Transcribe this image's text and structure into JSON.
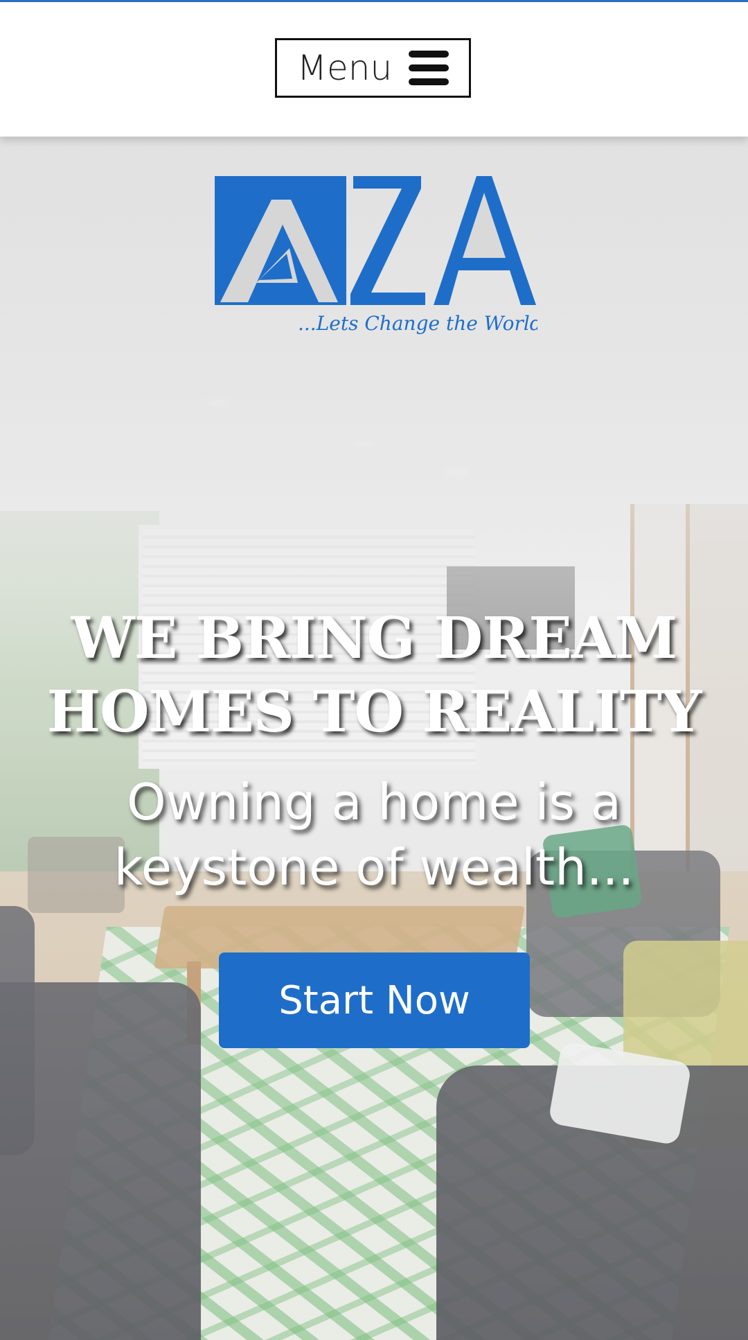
{
  "header": {
    "menu_label": "Menu"
  },
  "logo": {
    "letters": "ZA",
    "tagline": "...Lets Change the World",
    "brand_color": "#1e6ec9"
  },
  "hero": {
    "headline_line1": "WE BRING DREAM",
    "headline_line2": "HOMES TO REALITY",
    "sub_line1": "Owning a home is a",
    "sub_line2": "keystone of wealth...",
    "cta_label": "Start Now",
    "cta_color": "#1e6ec9"
  },
  "icons": {
    "menu": "hamburger-icon"
  }
}
